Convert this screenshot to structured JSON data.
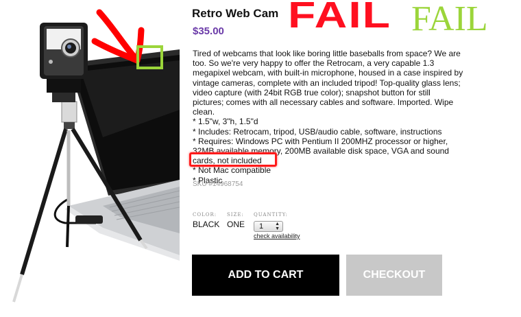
{
  "product": {
    "title": "Retro Web Cam",
    "price": "$35.00",
    "description": "Tired of webcams that look like boring little baseballs from space? We are too. So we're very happy to offer the Retrocam, a very capable 1.3 megapixel webcam, with built-in microphone, housed in a case inspired by vintage cameras, complete with an included tripod! Top-quality glass lens; video capture (with 24bit RGB true color); snapshot button for still pictures; comes with all necessary cables and software. Imported. Wipe clean.",
    "specs": [
      "* 1.5\"w, 3\"h, 1.5\"d",
      "* Includes: Retrocam, tripod, USB/audio cable, software, instructions",
      "* Requires: Windows PC with Pentium II 200MHZ processor or higher, 32MB available memory, 200MB available disk space, VGA and sound cards, not included",
      "* Not Mac compatible",
      "* Plastic"
    ],
    "sku": "SKU #14968754"
  },
  "overlay": {
    "fail_red": "FAIL",
    "fail_green": "FAIL",
    "colors": {
      "red": "#ff1020",
      "green": "#9bd53a",
      "highlight": "#ff1a1a"
    }
  },
  "options": {
    "color_label": "COLOR:",
    "color_value": "BLACK",
    "size_label": "SIZE:",
    "size_value": "ONE",
    "quantity_label": "QUANTITY:",
    "quantity_value": "1",
    "availability_link": "check availability"
  },
  "actions": {
    "add_to_cart": "ADD TO CART",
    "checkout": "CHECKOUT"
  },
  "theme": {
    "price_color": "#6a3aa8"
  }
}
